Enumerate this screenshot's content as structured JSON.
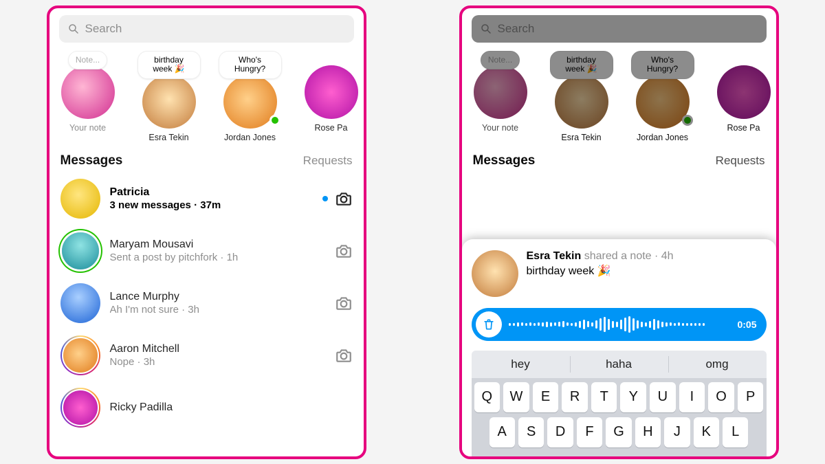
{
  "search": {
    "placeholder": "Search"
  },
  "notes": {
    "your_bubble": "Note...",
    "your_label": "Your note",
    "items": [
      {
        "bubble": "birthday week 🎉",
        "name": "Esra Tekin",
        "online": false
      },
      {
        "bubble": "Who's Hungry?",
        "name": "Jordan Jones",
        "online": true
      },
      {
        "bubble": "",
        "name": "Rose Pa",
        "online": false
      }
    ]
  },
  "section": {
    "title": "Messages",
    "requests": "Requests"
  },
  "threads": [
    {
      "name": "Patricia",
      "sub": "3 new messages · 37m",
      "unread": true
    },
    {
      "name": "Maryam Mousavi",
      "sub": "Sent a post by pitchfork · 1h",
      "unread": false
    },
    {
      "name": "Lance Murphy",
      "sub": "Ah I'm not sure · 3h",
      "unread": false
    },
    {
      "name": "Aaron Mitchell",
      "sub": "Nope · 3h",
      "unread": false
    },
    {
      "name": "Ricky Padilla",
      "sub": "",
      "unread": false
    }
  ],
  "sheet": {
    "author": "Esra Tekin",
    "action": "shared a note",
    "time": "4h",
    "body": "birthday week 🎉",
    "voice_time": "0:05",
    "suggestions": [
      "hey",
      "haha",
      "omg"
    ],
    "keys_row1": [
      "Q",
      "W",
      "E",
      "R",
      "T",
      "Y",
      "U",
      "I",
      "O",
      "P"
    ],
    "keys_row2": [
      "A",
      "S",
      "D",
      "F",
      "G",
      "H",
      "J",
      "K",
      "L"
    ]
  }
}
